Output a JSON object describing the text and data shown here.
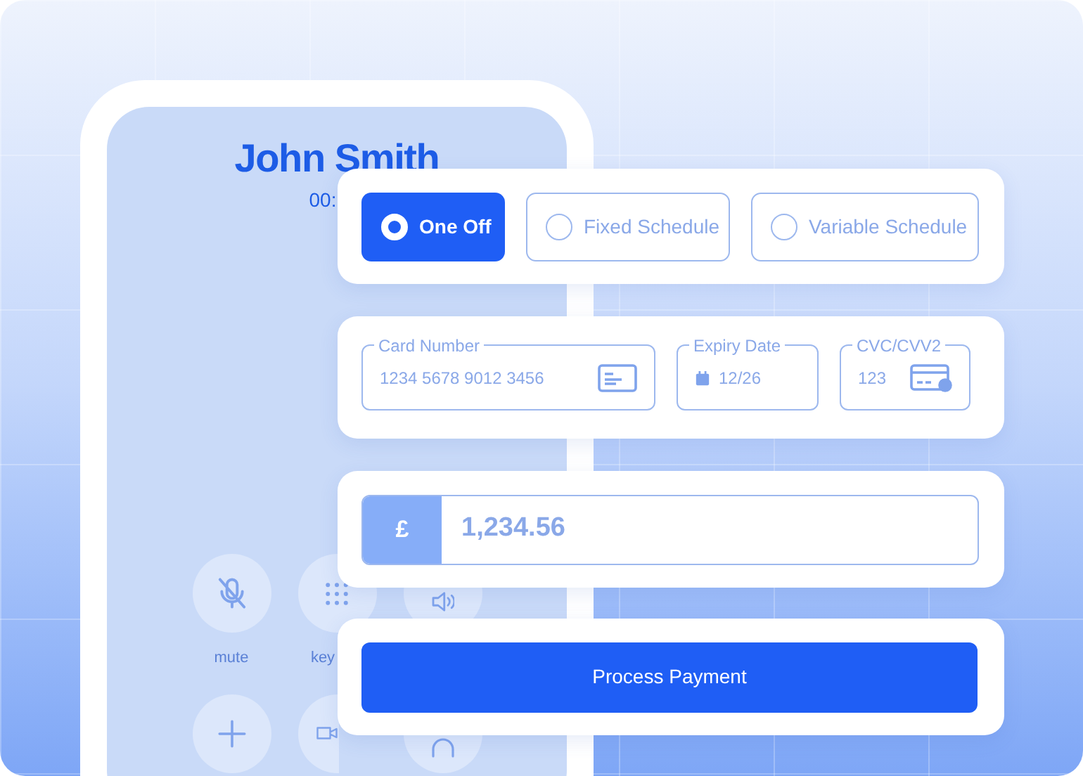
{
  "caller": {
    "name": "John Smith",
    "timer": "00:"
  },
  "call_buttons": {
    "labels": [
      "mute",
      "key"
    ]
  },
  "payment_types": [
    {
      "label": "One Off",
      "selected": true
    },
    {
      "label": "Fixed Schedule",
      "selected": false
    },
    {
      "label": "Variable Schedule",
      "selected": false
    }
  ],
  "card_fields": [
    {
      "label": "Card Number",
      "value": "1234 5678 9012 3456"
    },
    {
      "label": "Expiry Date",
      "value": "12/26"
    },
    {
      "label": "CVC/CVV2",
      "value": "123"
    }
  ],
  "amount": {
    "currency": "£",
    "value": "1,234.56"
  },
  "submit": {
    "label": "Process Payment"
  }
}
